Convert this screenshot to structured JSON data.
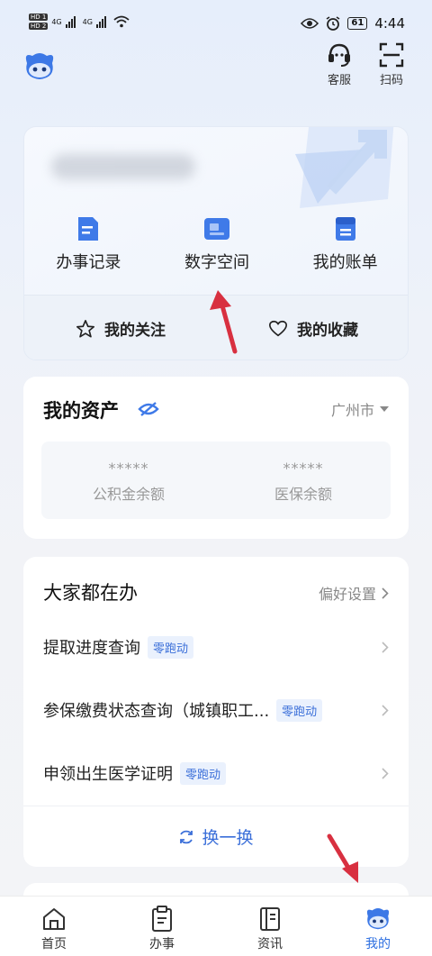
{
  "status": {
    "hd1": "HD 1",
    "hd2": "HD 2",
    "net1": "4G",
    "net2": "4G",
    "battery": "61",
    "time": "4:44"
  },
  "top": {
    "service_label": "客服",
    "scan_label": "扫码"
  },
  "profile": {
    "actions": [
      {
        "label": "办事记录",
        "icon": "record-icon"
      },
      {
        "label": "数字空间",
        "icon": "digital-space-icon"
      },
      {
        "label": "我的账单",
        "icon": "bill-icon"
      }
    ],
    "follow_label": "我的关注",
    "collect_label": "我的收藏"
  },
  "assets": {
    "title": "我的资产",
    "city": "广州市",
    "items": [
      {
        "value": "*****",
        "label": "公积金余额"
      },
      {
        "value": "*****",
        "label": "医保余额"
      }
    ]
  },
  "popular": {
    "title": "大家都在办",
    "pref_label": "偏好设置",
    "items": [
      {
        "label": "提取进度查询",
        "tag": "零跑动"
      },
      {
        "label": "参保缴费状态查询（城镇职工...",
        "tag": "零跑动"
      },
      {
        "label": "申领出生医学证明",
        "tag": "零跑动"
      }
    ],
    "refresh_label": "换一换"
  },
  "tabs": [
    {
      "label": "首页",
      "icon": "home-icon"
    },
    {
      "label": "办事",
      "icon": "clipboard-icon"
    },
    {
      "label": "资讯",
      "icon": "news-icon"
    },
    {
      "label": "我的",
      "icon": "profile-mascot-icon"
    }
  ],
  "colors": {
    "accent": "#2d6fe0",
    "tag_bg": "#eaf1fd",
    "annotation_arrow": "#d83040"
  }
}
